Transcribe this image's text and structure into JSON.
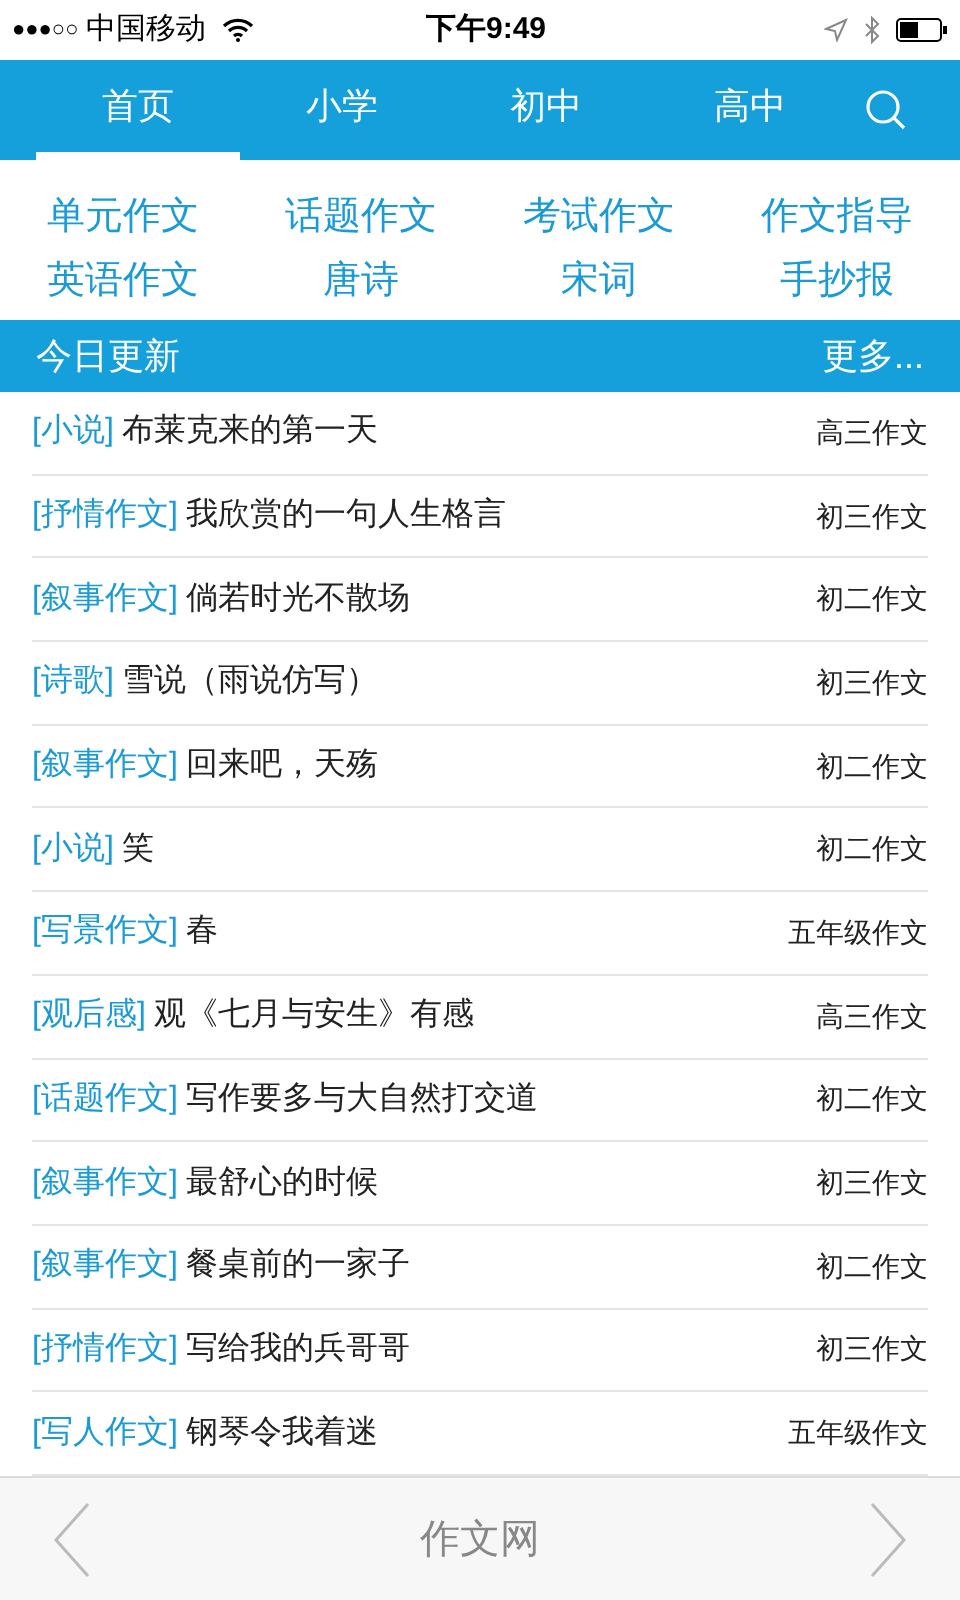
{
  "status_bar": {
    "signal": "●●●○○",
    "carrier": "中国移动",
    "time": "下午9:49"
  },
  "tabs": [
    {
      "label": "首页",
      "selected": true
    },
    {
      "label": "小学",
      "selected": false
    },
    {
      "label": "初中",
      "selected": false
    },
    {
      "label": "高中",
      "selected": false
    }
  ],
  "categories": [
    "单元作文",
    "话题作文",
    "考试作文",
    "作文指导",
    "英语作文",
    "唐诗",
    "宋词",
    "手抄报"
  ],
  "section": {
    "title": "今日更新",
    "more": "更多..."
  },
  "articles": [
    {
      "tag": "[小说]",
      "title": "布莱克来的第一天",
      "grade": "高三作文"
    },
    {
      "tag": "[抒情作文]",
      "title": "我欣赏的一句人生格言",
      "grade": "初三作文"
    },
    {
      "tag": "[叙事作文]",
      "title": "倘若时光不散场",
      "grade": "初二作文"
    },
    {
      "tag": "[诗歌]",
      "title": "雪说（雨说仿写）",
      "grade": "初三作文"
    },
    {
      "tag": "[叙事作文]",
      "title": "回来吧，天殇",
      "grade": "初二作文"
    },
    {
      "tag": "[小说]",
      "title": "笑",
      "grade": "初二作文"
    },
    {
      "tag": "[写景作文]",
      "title": "春",
      "grade": "五年级作文"
    },
    {
      "tag": "[观后感]",
      "title": "观《七月与安生》有感",
      "grade": "高三作文"
    },
    {
      "tag": "[话题作文]",
      "title": "写作要多与大自然打交道",
      "grade": "初二作文"
    },
    {
      "tag": "[叙事作文]",
      "title": "最舒心的时候",
      "grade": "初三作文"
    },
    {
      "tag": "[叙事作文]",
      "title": "餐桌前的一家子",
      "grade": "初二作文"
    },
    {
      "tag": "[抒情作文]",
      "title": "写给我的兵哥哥",
      "grade": "初三作文"
    },
    {
      "tag": "[写人作文]",
      "title": "钢琴令我着迷",
      "grade": "五年级作文"
    }
  ],
  "bottom_bar": {
    "title": "作文网"
  }
}
